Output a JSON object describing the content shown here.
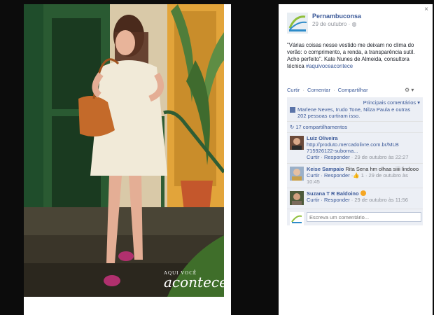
{
  "photo": {
    "brand_small": "AQUI VOCÊ",
    "brand_big": "acontece"
  },
  "post": {
    "close_glyph": "×",
    "page_name": "Pernambuconsa",
    "date": "29 de outubro ·",
    "text": "\"Várias coisas nesse vestido me deixam no clima do verão: o comprimento, a renda, a transparência sutil. Acho perfeito\". Kate Nunes de Almeida, consultora técnica ",
    "hashtag": "#aquivoceacontece",
    "actions": [
      "Curtir",
      "Comentar",
      "Compartilhar"
    ],
    "action_sep": "·",
    "settings_glyph": "⚙ ▾"
  },
  "feedback": {
    "order_label": "Principais comentários ▾",
    "likes_names": "Marlene Neves, Irudo",
    "likes_rest": " Tone, Nilza Paula e outras 202 pessoas curtiram isso.",
    "shares": "17 compartilhamentos",
    "comments": [
      {
        "author": "Luiz Oliveira",
        "text": "",
        "link": "http://produto.mercadolivre.com.br/MLB 715926122-suborna...",
        "actions": "Curtir · Responder",
        "time": " · 29 de outubro às 22:27"
      },
      {
        "author": "Keise Sampaio",
        "text": " Rita Sena hm olhaa siiii lindooo",
        "link": "",
        "actions": "Curtir · Responder ·",
        "likes": " 1",
        "time": " · 29 de outubro às 10:45"
      },
      {
        "author": "Suzana T R Baldoino",
        "text": " ",
        "link": "",
        "actions": "Curtir · Responder",
        "time": " · 29 de outubro às 11:56"
      }
    ],
    "input_placeholder": "Escreva um comentário..."
  },
  "colors": {
    "link": "#3b5998",
    "panel_bg": "#eceff5",
    "page_bg": "#0c0c0c"
  }
}
